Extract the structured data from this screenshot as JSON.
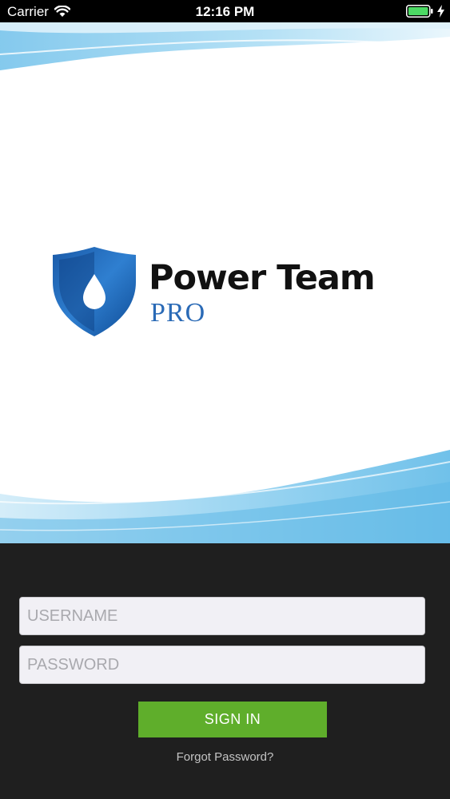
{
  "status_bar": {
    "carrier": "Carrier",
    "time": "12:16 PM"
  },
  "brand": {
    "name": "Power Team",
    "sub": "PRO"
  },
  "login": {
    "username_placeholder": "USERNAME",
    "password_placeholder": "PASSWORD",
    "signin_label": "SIGN IN",
    "forgot_label": "Forgot Password?"
  },
  "colors": {
    "accent_green": "#5fae2b",
    "brand_blue": "#1f5fae",
    "background_dark": "#1f1f1f"
  },
  "icons": [
    "wifi-icon",
    "battery-icon",
    "charging-bolt-icon",
    "shield-drop-logo-icon"
  ]
}
